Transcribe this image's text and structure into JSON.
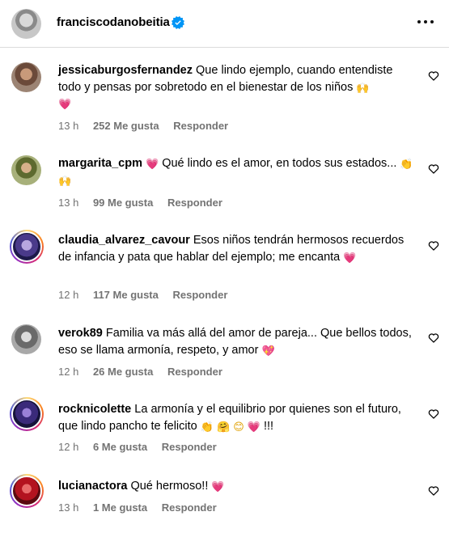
{
  "post": {
    "username": "franciscodanobeitia"
  },
  "comments": [
    {
      "username": "jessicaburgosfernandez",
      "text": "Que lindo ejemplo, cuando entendiste todo y pensas por sobretodo en el bienestar de los niños",
      "emojis": [
        "🙌",
        "💗"
      ],
      "time": "13 h",
      "likes": "252 Me gusta",
      "reply": "Responder"
    },
    {
      "username": "margarita_cpm",
      "text_pre_emoji": "💗",
      "text": "Qué lindo es el amor, en todos sus estados...",
      "emojis": [
        "👏",
        "🙌"
      ],
      "time": "13 h",
      "likes": "99 Me gusta",
      "reply": "Responder"
    },
    {
      "username": "claudia_alvarez_cavour",
      "text": "Esos niños tendrán hermosos recuerdos de infancia y pata que hablar del ejemplo; me encanta",
      "emojis": [
        "💗"
      ],
      "time": "12 h",
      "likes": "117 Me gusta",
      "reply": "Responder"
    },
    {
      "username": "verok89",
      "text": "Familia va más allá del amor de pareja... Que bellos todos, eso se llama armonía, respeto, y amor",
      "emojis": [
        "💖"
      ],
      "time": "12 h",
      "likes": "26 Me gusta",
      "reply": "Responder"
    },
    {
      "username": "rocknicolette",
      "text": "La armonía y el equilibrio por quienes son el futuro, que lindo pancho te felicito",
      "emojis": [
        "👏",
        "🤗",
        "😊",
        "💗"
      ],
      "tail": "!!!",
      "time": "12 h",
      "likes": "6 Me gusta",
      "reply": "Responder"
    },
    {
      "username": "lucianactora",
      "text": "Qué hermoso!!",
      "emojis": [
        "💗"
      ],
      "time": "13 h",
      "likes": "1 Me gusta",
      "reply": "Responder"
    }
  ],
  "icons": {
    "verified": "verified-badge-icon",
    "more": "more-options-icon",
    "like": "heart-outline-icon"
  },
  "colors": {
    "verified": "#0095f6",
    "secondary_text": "#737373",
    "emoji_heart": "#e8336e"
  }
}
